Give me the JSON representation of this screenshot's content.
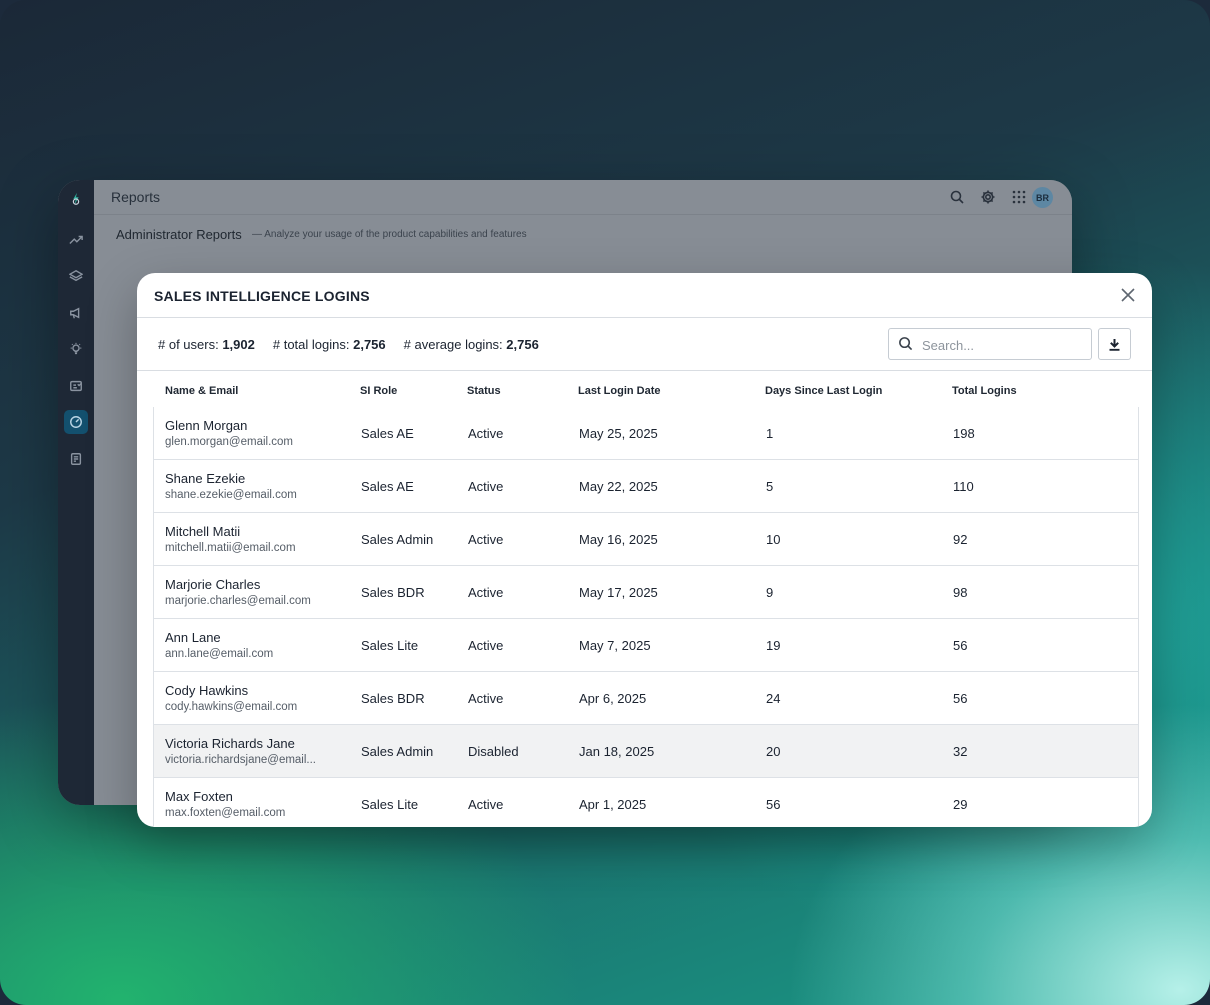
{
  "app": {
    "title": "Reports",
    "avatar_initials": "BR",
    "section_title": "Administrator Reports",
    "section_subtitle": "— Analyze your usage of the product capabilities and features",
    "sidebar_icons": [
      "logo-icon",
      "trending-icon",
      "layers-icon",
      "megaphone-icon",
      "lightbulb-icon",
      "document-check-icon",
      "gauge-icon",
      "report-icon"
    ],
    "active_sidebar_item": "gauge-icon"
  },
  "modal": {
    "title": "SALES INTELLIGENCE LOGINS",
    "stats": {
      "users_label": "# of users:",
      "users_value": "1,902",
      "logins_label": "# total logins:",
      "logins_value": "2,756",
      "avg_label": "# average logins:",
      "avg_value": "2,756"
    },
    "search": {
      "placeholder": "Search...",
      "value": ""
    },
    "columns": [
      "Name & Email",
      "SI Role",
      "Status",
      "Last Login Date",
      "Days Since Last Login",
      "Total Logins"
    ],
    "rows": [
      {
        "name": "Glenn Morgan",
        "email": "glen.morgan@email.com",
        "role": "Sales AE",
        "status": "Active",
        "last_login": "May 25, 2025",
        "days_since": "1",
        "total": "198"
      },
      {
        "name": "Shane Ezekie",
        "email": "shane.ezekie@email.com",
        "role": "Sales AE",
        "status": "Active",
        "last_login": "May 22, 2025",
        "days_since": "5",
        "total": "110"
      },
      {
        "name": "Mitchell Matii",
        "email": "mitchell.matii@email.com",
        "role": "Sales Admin",
        "status": "Active",
        "last_login": "May 16, 2025",
        "days_since": "10",
        "total": "92"
      },
      {
        "name": "Marjorie Charles",
        "email": "marjorie.charles@email.com",
        "role": "Sales BDR",
        "status": "Active",
        "last_login": "May 17, 2025",
        "days_since": "9",
        "total": "98"
      },
      {
        "name": "Ann Lane",
        "email": "ann.lane@email.com",
        "role": "Sales Lite",
        "status": "Active",
        "last_login": "May 7, 2025",
        "days_since": "19",
        "total": "56"
      },
      {
        "name": "Cody Hawkins",
        "email": "cody.hawkins@email.com",
        "role": "Sales BDR",
        "status": "Active",
        "last_login": "Apr 6, 2025",
        "days_since": "24",
        "total": "56"
      },
      {
        "name": "Victoria Richards Jane",
        "email": "victoria.richardsjane@email...",
        "role": "Sales Admin",
        "status": "Disabled",
        "last_login": "Jan 18, 2025",
        "days_since": "20",
        "total": "32"
      },
      {
        "name": "Max Foxten",
        "email": "max.foxten@email.com",
        "role": "Sales Lite",
        "status": "Active",
        "last_login": "Apr 1, 2025",
        "days_since": "56",
        "total": "29"
      }
    ]
  }
}
